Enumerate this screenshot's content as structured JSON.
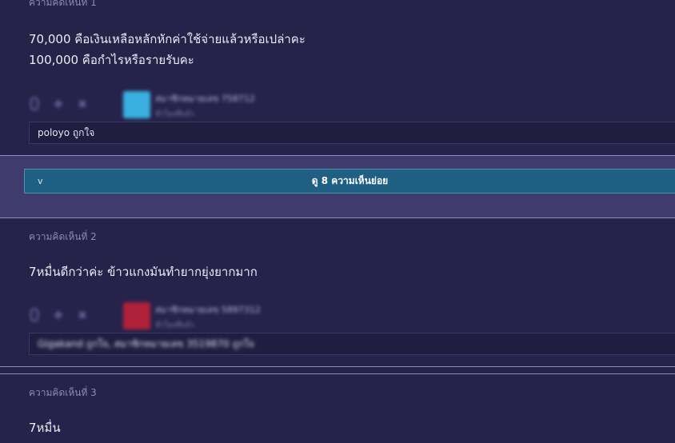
{
  "comments": [
    {
      "label": "ความคิดเห็นที่ 1",
      "lines": [
        "70,000 คือเงินเหลือหลักหักค่าใช้จ่ายแล้วหรือเปล่าคะ",
        "100,000 คือกำไรหรือรายรับคะ"
      ],
      "vote_count": "0",
      "username": "สมาชิกหมายเลข 758712",
      "date": "ชั่วโมงที่แล้ว",
      "emotion_text": "poloyo ถูกใจ",
      "avatar_color": "#3ab0e0"
    },
    {
      "label": "ความคิดเห็นที่ 2",
      "lines": [
        "7หมื่นดีกว่าค่ะ ข้าวแกงมันทำยากยุ่งยากมาก"
      ],
      "vote_count": "0",
      "username": "สมาชิกหมายเลข 5897312",
      "date": "ชั่วโมงที่แล้ว",
      "emotion_text": "Gigakand ถูกใจ, สมาชิกหมายเลข 3519870 ถูกใจ",
      "avatar_color": "#b0223a"
    },
    {
      "label": "ความคิดเห็นที่ 3",
      "lines": [
        "7หมื่น"
      ]
    }
  ],
  "expand": {
    "label": "ดู 8 ความเห็นย่อย",
    "icon": "chevron-down-icon"
  },
  "vote": {
    "up_icon": "plus-icon",
    "down_icon": "minus-icon"
  },
  "colors": {
    "background": "#25234a",
    "expand_band": "#3f3b6c",
    "expand_button": "#1f5f84"
  }
}
